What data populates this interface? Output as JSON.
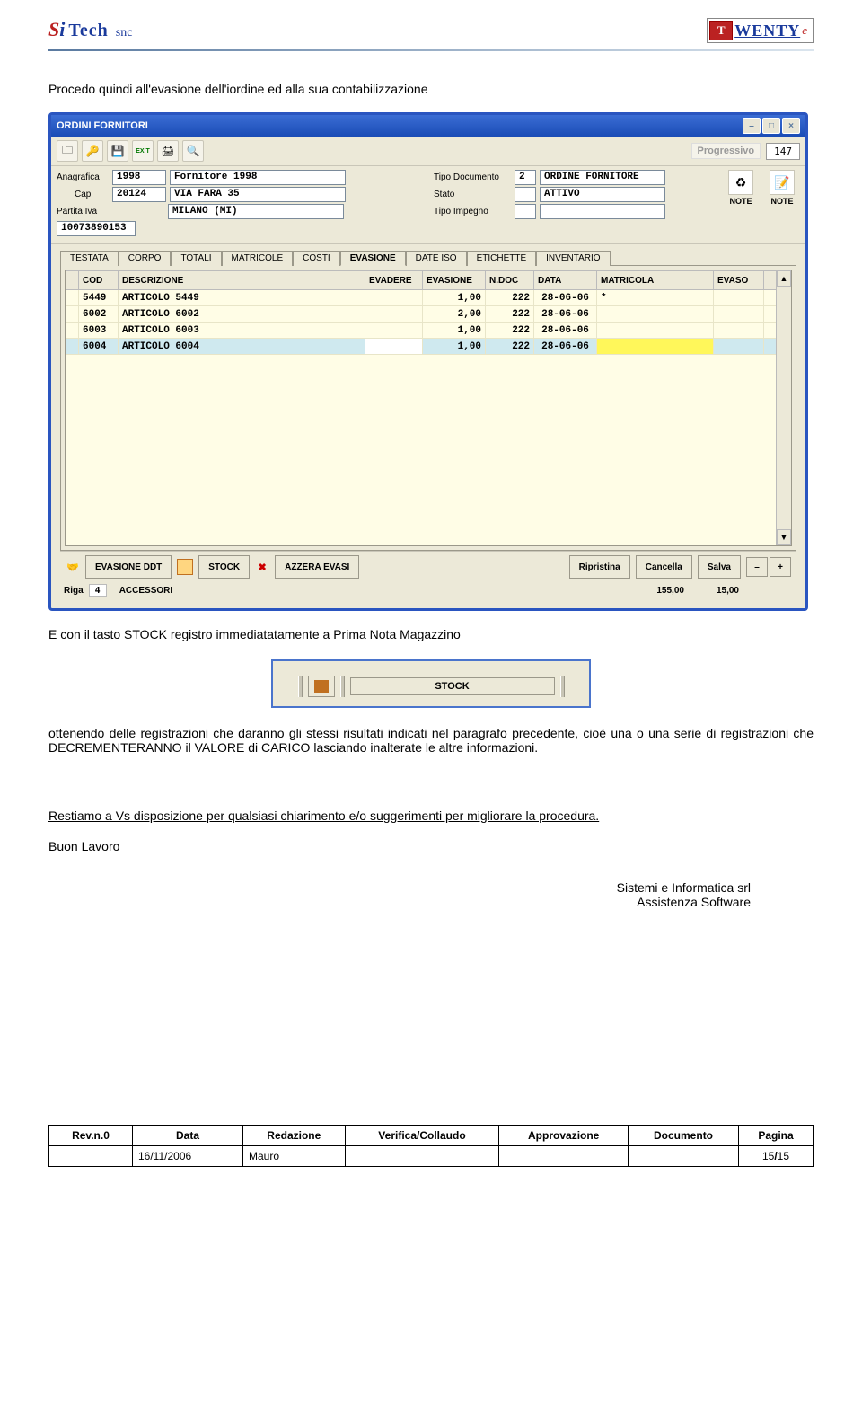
{
  "header": {
    "logo_left": {
      "si_s": "S",
      "si_i": "i",
      "tech": " Tech",
      "snc": "snc"
    },
    "logo_right": {
      "badge": "T",
      "text": "WENTY",
      "suffix": "e"
    }
  },
  "intro_text": "Procedo quindi all'evasione dell'iordine ed alla sua contabilizzazione",
  "app": {
    "title": "ORDINI FORNITORI",
    "titlebar_icons": {
      "min": "–",
      "max": "□",
      "close": "×"
    },
    "toolbar_icons": {
      "new": "🗀",
      "key": "🔑",
      "save": "💾",
      "exit": "EXIT",
      "print": "🖨",
      "preview": "🔍"
    },
    "progressivo": {
      "label": "Progressivo",
      "value": "147"
    },
    "form": {
      "anagrafica_label": "Anagrafica",
      "anagrafica_code": "1998",
      "anagrafica_name": "Fornitore 1998",
      "cap_label": "Cap",
      "cap_value": "20124",
      "address": "VIA FARA 35",
      "city": "MILANO (MI)",
      "partita_iva_label": "Partita Iva",
      "partita_iva_value": "10073890153",
      "tipo_documento_label": "Tipo Documento",
      "tipo_documento_code": "2",
      "tipo_documento_name": "ORDINE FORNITORE",
      "stato_label": "Stato",
      "stato_value": "ATTIVO",
      "tipo_impegno_label": "Tipo Impegno",
      "tipo_impegno_value": "",
      "note_upper": "NOTE",
      "note_lower": "NOTE"
    },
    "tabs": [
      {
        "label": "TESTATA",
        "active": false
      },
      {
        "label": "CORPO",
        "active": false
      },
      {
        "label": "TOTALI",
        "active": false
      },
      {
        "label": "MATRICOLE",
        "active": false
      },
      {
        "label": "COSTI",
        "active": false
      },
      {
        "label": "EVASIONE",
        "active": true
      },
      {
        "label": "DATE ISO",
        "active": false
      },
      {
        "label": "ETICHETTE",
        "active": false
      },
      {
        "label": "INVENTARIO",
        "active": false
      }
    ],
    "grid": {
      "columns": [
        "",
        "COD",
        "DESCRIZIONE",
        "EVADERE",
        "EVASIONE",
        "N.DOC",
        "DATA",
        "MATRICOLA",
        "EVASO",
        ""
      ],
      "rows": [
        {
          "cod": "5449",
          "desc": "ARTICOLO 5449",
          "evadere": "",
          "evasione": "1,00",
          "ndoc": "222",
          "data": "28-06-06",
          "matricola": "*",
          "evaso": "",
          "selected": false
        },
        {
          "cod": "6002",
          "desc": "ARTICOLO 6002",
          "evadere": "",
          "evasione": "2,00",
          "ndoc": "222",
          "data": "28-06-06",
          "matricola": "",
          "evaso": "",
          "selected": false
        },
        {
          "cod": "6003",
          "desc": "ARTICOLO 6003",
          "evadere": "",
          "evasione": "1,00",
          "ndoc": "222",
          "data": "28-06-06",
          "matricola": "",
          "evaso": "",
          "selected": false
        },
        {
          "cod": "6004",
          "desc": "ARTICOLO 6004",
          "evadere": "",
          "evasione": "1,00",
          "ndoc": "222",
          "data": "28-06-06",
          "matricola": "",
          "evaso": "",
          "selected": true
        }
      ],
      "scroll": {
        "up": "▲",
        "down": "▼"
      }
    },
    "buttons": {
      "evasione_ddt": "EVASIONE DDT",
      "stock": "STOCK",
      "azzera_evasi": "AZZERA EVASI",
      "ripristina": "Ripristina",
      "cancella": "Cancella",
      "salva": "Salva",
      "minus": "–",
      "plus": "+",
      "handshake": "🤝"
    },
    "status": {
      "riga_label": "Riga",
      "riga_value": "4",
      "group": "ACCESSORI",
      "tot1": "155,00",
      "tot2": "15,00"
    }
  },
  "after_app_text": "E con il tasto STOCK registro immediatatamente a Prima Nota Magazzino",
  "stock_mini": {
    "label": "STOCK"
  },
  "para_after_stock": "ottenendo delle registrazioni che daranno gli stessi risultati indicati nel paragrafo precedente, cioè una o una serie di registrazioni che DECREMENTERANNO il VALORE di CARICO lasciando inalterate le altre informazioni.",
  "closing_para": "Restiamo a Vs disposizione per qualsiasi chiarimento e/o suggerimenti per migliorare la procedura.",
  "buon_lavoro": "Buon Lavoro",
  "signature": {
    "line1": "Sistemi e Informatica srl",
    "line2": "Assistenza Software"
  },
  "footer": {
    "headers": [
      "Rev.n.0",
      "Data",
      "Redazione",
      "Verifica/Collaudo",
      "Approvazione",
      "Documento",
      "Pagina"
    ],
    "row": {
      "rev": "",
      "data": "16/11/2006",
      "redazione": "Mauro",
      "verifica": "",
      "approvazione": "",
      "documento": "",
      "pagina_cur": "15",
      "pagina_sep": "/",
      "pagina_tot": "15"
    }
  }
}
